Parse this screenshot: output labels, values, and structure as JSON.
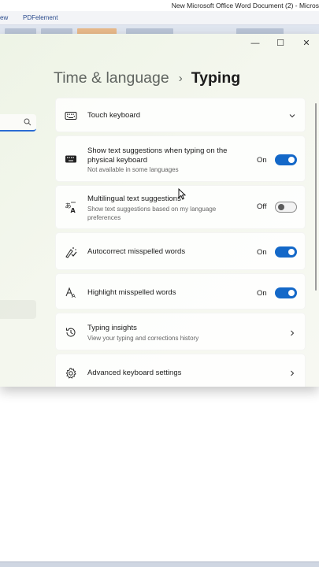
{
  "word": {
    "title": "New Microsoft Office Word Document (2)  -  Micros",
    "menu_item_1": "ew",
    "menu_item_2": "PDFelement"
  },
  "settings": {
    "breadcrumb": {
      "parent": "Time & language",
      "separator": "›",
      "current": "Typing"
    },
    "controls": {
      "minimize": "—",
      "maximize": "☐",
      "close": "✕"
    },
    "items": [
      {
        "title": "Touch keyboard",
        "icon": "keyboard-icon",
        "control": "chevron-down"
      },
      {
        "title": "Show text suggestions when typing on the physical keyboard",
        "title_line1": "Show text suggestions when typing on the",
        "title_line2": "physical keyboard",
        "subtitle": "Not available in some languages",
        "icon": "keyboard-icon",
        "state": "On",
        "toggle": "on"
      },
      {
        "title": "Multilingual text suggestions",
        "subtitle_line1": "Show text suggestions based on my language",
        "subtitle_line2": "preferences",
        "icon": "multilingual-icon",
        "state": "Off",
        "toggle": "off"
      },
      {
        "title": "Autocorrect misspelled words",
        "icon": "autocorrect-icon",
        "state": "On",
        "toggle": "on"
      },
      {
        "title": "Highlight misspelled words",
        "icon": "highlight-icon",
        "state": "On",
        "toggle": "on"
      },
      {
        "title": "Typing insights",
        "subtitle": "View your typing and corrections history",
        "icon": "history-icon",
        "control": "chevron-right"
      },
      {
        "title": "Advanced keyboard settings",
        "icon": "gear-icon",
        "control": "chevron-right"
      }
    ]
  },
  "colors": {
    "accent": "#1468c8",
    "search_underline": "#2b6cd4"
  }
}
